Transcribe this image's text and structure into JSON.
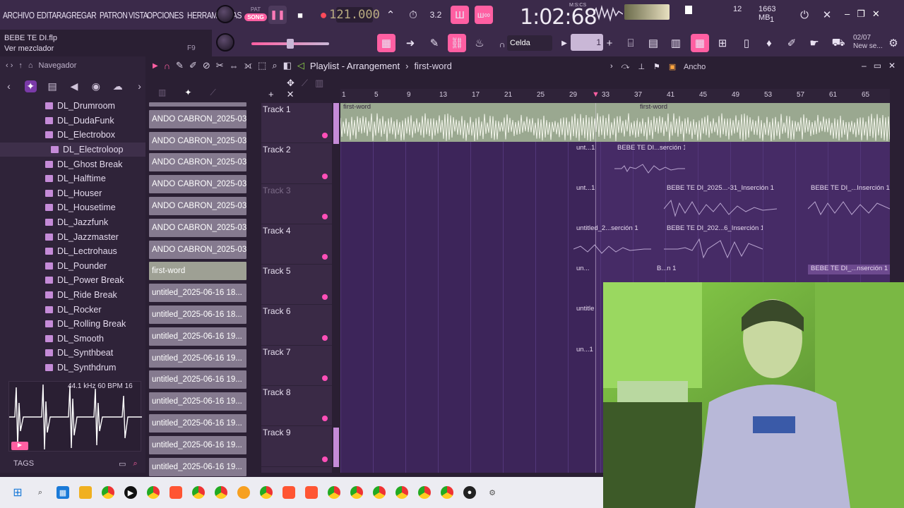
{
  "menu": [
    "ARCHIVO",
    "EDITAR",
    "AGREGAR",
    "PATRON",
    "VISTA",
    "OPCIONES",
    "HERRAMIENTAS"
  ],
  "transport": {
    "pat_label": "PAT",
    "song_label": "SONG",
    "bpm": "121.000",
    "time": "1:02:68",
    "time_unit": "M:S:CS"
  },
  "hint": {
    "title": "BEBE TE DI.flp",
    "line": "Ver mezclador",
    "key": "F9"
  },
  "cpu": {
    "value1": "12",
    "memory": "1663 MB",
    "value2": "1"
  },
  "snap": {
    "label": "Celda"
  },
  "step": {
    "value": "1"
  },
  "news": {
    "date": "02/07",
    "label": "New se..."
  },
  "browser": {
    "title": "Navegador",
    "folders": [
      "DL_Drumroom",
      "DL_DudaFunk",
      "DL_Electrobox",
      "DL_Electroloop",
      "DL_Ghost Break",
      "DL_Halftime",
      "DL_Houser",
      "DL_Housetime",
      "DL_Jazzfunk",
      "DL_Jazzmaster",
      "DL_Lectrohaus",
      "DL_Pounder",
      "DL_Power Break",
      "DL_Ride Break",
      "DL_Rocker",
      "DL_Rolling Break",
      "DL_Smooth",
      "DL_Synthbeat",
      "DL_Synthdrum"
    ],
    "selected_index": 3,
    "sample_info": "44.1 kHz 60 BPM 16",
    "tags_label": "TAGS"
  },
  "clips": [
    "ANDO CABRON_2025-03-...",
    "ANDO CABRON_2025-03-...",
    "ANDO CABRON_2025-03-...",
    "ANDO CABRON_2025-03-...",
    "ANDO CABRON_2025-03-...",
    "ANDO CABRON_2025-03-...",
    "ANDO CABRON_2025-03-...",
    "first-word",
    "untitled_2025-06-16 18...",
    "untitled_2025-06-16 18...",
    "untitled_2025-06-16 19...",
    "untitled_2025-06-16 19...",
    "untitled_2025-06-16 19...",
    "untitled_2025-06-16 19...",
    "untitled_2025-06-16 19...",
    "untitled_2025-06-16 19...",
    "untitled_2025-06-16 19..."
  ],
  "playlist": {
    "title": "Playlist - Arrangement",
    "pattern": "first-word",
    "width_label": "Ancho",
    "ruler": [
      "1",
      "5",
      "9",
      "13",
      "17",
      "21",
      "25",
      "29",
      "33",
      "37",
      "41",
      "45",
      "49",
      "53",
      "57",
      "61",
      "65"
    ],
    "tracks": [
      "Track 1",
      "Track 2",
      "Track 3",
      "Track 4",
      "Track 5",
      "Track 6",
      "Track 7",
      "Track 8",
      "Track 9"
    ],
    "clip_labels": {
      "t1a": "first-word",
      "t1b": "first-word",
      "t2a": "unt...1",
      "t2b": "BEBE TE DI...serción 1",
      "t3a": "unt...1",
      "t3b": "BEBE TE DI_2025...-31_Inserción 1",
      "t3c": "BEBE TE DI_...Inserción 1",
      "t4a": "untitled_2...serción 1",
      "t4b": "BEBE TE DI_202...6_Inserción 1",
      "t5a": "un...",
      "t5b": "B...n 1",
      "t5c": "BEBE TE DI_...nserción 1",
      "t6a": "untitle",
      "t7a": "un...1"
    }
  },
  "colors": {
    "accent": "#ff5fa2",
    "playlist_bg": "#462b66",
    "panel": "#2f2339"
  }
}
